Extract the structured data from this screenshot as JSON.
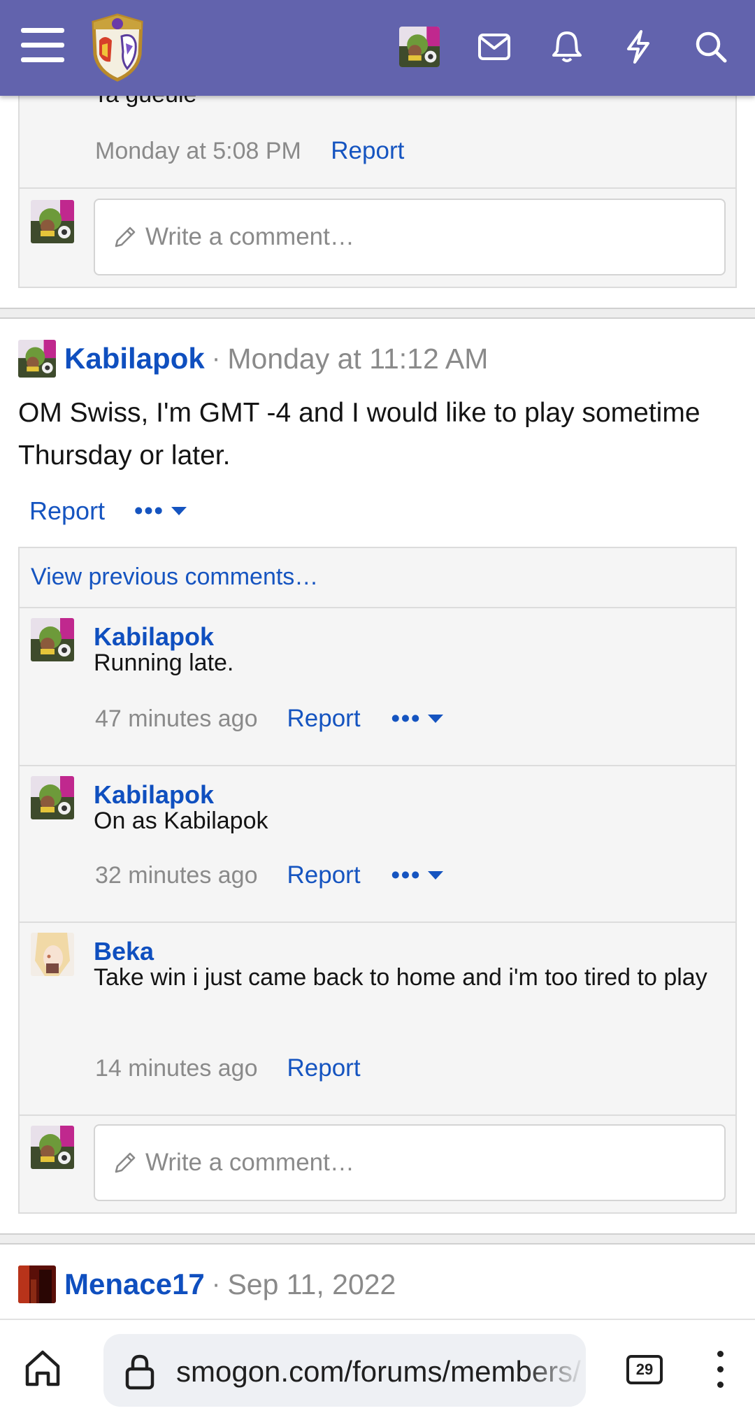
{
  "topbar": {
    "menu_icon": "hamburger-menu-icon",
    "logo_icon": "site-logo",
    "icons": [
      "mail-icon",
      "bell-icon",
      "bolt-icon",
      "search-icon"
    ],
    "brand_color": "#6263ad"
  },
  "first_block": {
    "partial_text": "Ta gueule",
    "time": "Monday at 5:08 PM",
    "report": "Report",
    "write_placeholder": "Write a comment…"
  },
  "post1": {
    "author": "Kabilapok",
    "separator": "·",
    "date": "Monday at 11:12 AM",
    "body": "OM Swiss, I'm GMT -4 and I would like to play sometime Thursday or later.",
    "report": "Report",
    "more": "•••"
  },
  "comments": {
    "view_previous": "View previous comments…",
    "items": [
      {
        "author": "Kabilapok",
        "text": "Running late.",
        "time": "47 minutes ago",
        "report": "Report",
        "more": "•••"
      },
      {
        "author": "Kabilapok",
        "text": "On as Kabilapok",
        "time": "32 minutes ago",
        "report": "Report",
        "more": "•••"
      },
      {
        "author": "Beka",
        "text": "Take win i just came back to home and i'm too tired to play",
        "time": "14 minutes ago",
        "report": "Report"
      }
    ],
    "write_placeholder": "Write a comment…"
  },
  "post2": {
    "author": "Menace17",
    "separator": "·",
    "date": "Sep 11, 2022"
  },
  "browser": {
    "url": "smogon.com/forums/members/",
    "tab_count": "29",
    "home_icon": "home-icon",
    "lock_icon": "lock-icon",
    "menu_icon": "kebab-menu-icon"
  }
}
